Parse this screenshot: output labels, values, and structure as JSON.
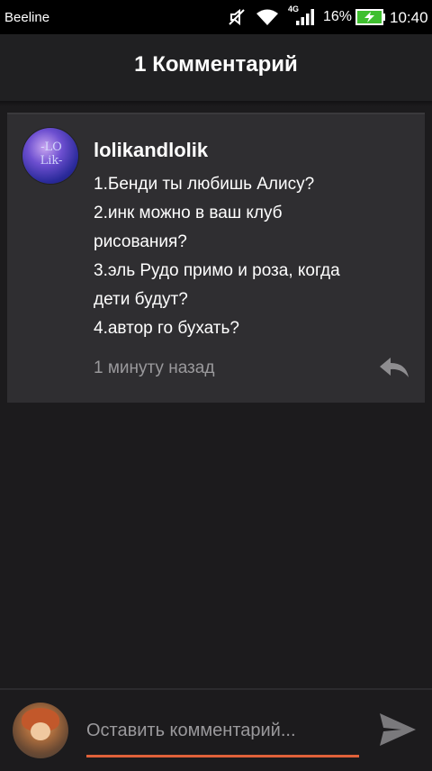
{
  "status_bar": {
    "carrier": "Beeline",
    "network_type": "4G",
    "battery_percent": "16%",
    "time": "10:40",
    "icons": [
      "mute-icon",
      "wifi-icon",
      "signal-icon",
      "battery-charging-icon"
    ]
  },
  "header": {
    "title": "1 Комментарий"
  },
  "comments": [
    {
      "username": "lolikandlolik",
      "avatar_text": "-LO\nLik-",
      "lines": [
        "1.Бенди ты любишь Алису?",
        "2.инк можно в ваш клуб",
        "рисования?",
        "3.эль Рудо примо и роза, когда",
        "дети будут?",
        "4.автор го бухать?"
      ],
      "timestamp": "1 минуту назад",
      "reply_icon": "reply-icon"
    }
  ],
  "composer": {
    "placeholder": "Оставить комментарий...",
    "value": "",
    "send_icon": "send-icon",
    "accent_color": "#e0613a"
  }
}
